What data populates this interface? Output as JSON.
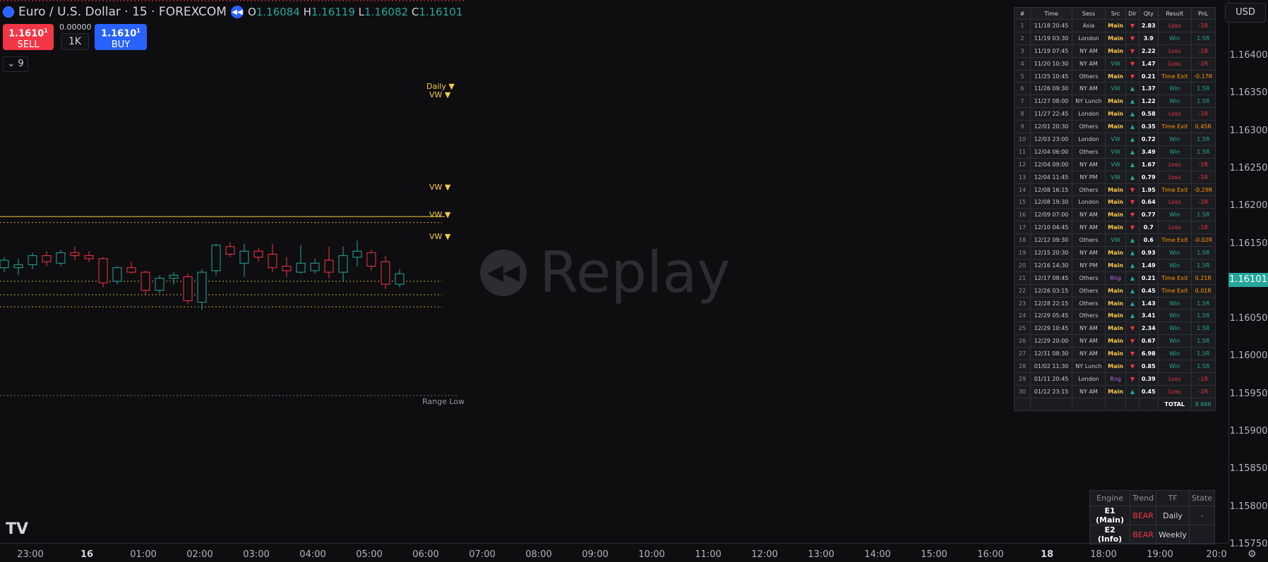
{
  "header": {
    "symbol_title": "Euro / U.S. Dollar · 15 · FOREXCOM",
    "open_label": "O",
    "open_value": "1.16084",
    "high_label": "H",
    "high_value": "1.16119",
    "low_label": "L",
    "low_value": "1.16082",
    "close_label": "C",
    "close_value": "1.16101"
  },
  "trade_panel": {
    "sell_price": "1.1610",
    "sell_price_sup": "1",
    "sell_label": "SELL",
    "spread": "0.00000",
    "quantity": "1K",
    "buy_price": "1.1610",
    "buy_price_sup": "1",
    "buy_label": "BUY"
  },
  "indicator_toggle": {
    "count": "9"
  },
  "levels": {
    "daily": "Daily ▼",
    "vw": "VW ▼",
    "range_low": "Range Low"
  },
  "watermark": {
    "text": "Replay"
  },
  "currency_button": "USD",
  "price_axis": {
    "labels": [
      "1.16400",
      "1.16350",
      "1.16300",
      "1.16250",
      "1.16200",
      "1.16150",
      "1.16050",
      "1.16000",
      "1.15950",
      "1.15900",
      "1.15850",
      "1.15800",
      "1.15750"
    ],
    "current_price": "1.16101"
  },
  "time_axis": {
    "labels": [
      "23:00",
      "16",
      "01:00",
      "02:00",
      "03:00",
      "04:00",
      "05:00",
      "06:00",
      "07:00",
      "08:00",
      "09:00",
      "10:00",
      "11:00",
      "12:00",
      "13:00",
      "14:00",
      "15:00",
      "16:00",
      "18",
      "18:00",
      "19:00",
      "20:0"
    ],
    "bold": [
      "16",
      "18"
    ]
  },
  "trades_table": {
    "headers": [
      "#",
      "Time",
      "Sess",
      "Src",
      "Dir",
      "Qty",
      "Result",
      "PnL"
    ],
    "rows": [
      [
        "1",
        "11/18 20:45",
        "Asia",
        "Main",
        "▼",
        "2.83",
        "Loss",
        "-1R"
      ],
      [
        "2",
        "11/19 03:30",
        "London",
        "Main",
        "▼",
        "3.9",
        "Win",
        "1.5R"
      ],
      [
        "3",
        "11/19 07:45",
        "NY AM",
        "Main",
        "▼",
        "2.22",
        "Loss",
        "-1R"
      ],
      [
        "4",
        "11/20 10:30",
        "NY AM",
        "VW",
        "▼",
        "1.47",
        "Loss",
        "-1R"
      ],
      [
        "5",
        "11/25 10:45",
        "Others",
        "Main",
        "▼",
        "0.21",
        "Time Exit",
        "-0.17R"
      ],
      [
        "6",
        "11/26 09:30",
        "NY AM",
        "VW",
        "▲",
        "1.37",
        "Win",
        "1.5R"
      ],
      [
        "7",
        "11/27 08:00",
        "NY Lunch",
        "Main",
        "▲",
        "1.22",
        "Win",
        "1.5R"
      ],
      [
        "8",
        "11/27 22:45",
        "London",
        "Main",
        "▲",
        "0.58",
        "Loss",
        "-1R"
      ],
      [
        "9",
        "12/01 20:30",
        "Others",
        "Main",
        "▲",
        "0.35",
        "Time Exit",
        "0.45R"
      ],
      [
        "10",
        "12/03 23:00",
        "London",
        "VW",
        "▲",
        "0.72",
        "Win",
        "1.5R"
      ],
      [
        "11",
        "12/04 06:00",
        "Others",
        "VW",
        "▲",
        "3.49",
        "Win",
        "1.5R"
      ],
      [
        "12",
        "12/04 09:00",
        "NY AM",
        "VW",
        "▲",
        "1.67",
        "Loss",
        "-1R"
      ],
      [
        "13",
        "12/04 11:45",
        "NY PM",
        "VW",
        "▲",
        "0.79",
        "Loss",
        "-1R"
      ],
      [
        "14",
        "12/08 16:15",
        "Others",
        "Main",
        "▼",
        "1.95",
        "Time Exit",
        "-0.29R"
      ],
      [
        "15",
        "12/08 19:30",
        "London",
        "Main",
        "▼",
        "0.64",
        "Loss",
        "-1R"
      ],
      [
        "16",
        "12/09 07:00",
        "NY AM",
        "Main",
        "▼",
        "0.77",
        "Win",
        "1.5R"
      ],
      [
        "17",
        "12/10 04:45",
        "NY AM",
        "Main",
        "▼",
        "0.7",
        "Loss",
        "-1R"
      ],
      [
        "18",
        "12/12 09:30",
        "Others",
        "VW",
        "▲",
        "0.6",
        "Time Exit",
        "-0.02R"
      ],
      [
        "19",
        "12/15 20:30",
        "NY AM",
        "Main",
        "▲",
        "0.93",
        "Win",
        "1.5R"
      ],
      [
        "20",
        "12/16 14:30",
        "NY PM",
        "Main",
        "▲",
        "1.49",
        "Win",
        "1.5R"
      ],
      [
        "21",
        "12/17 08:45",
        "Others",
        "Rng",
        "▲",
        "0.21",
        "Time Exit",
        "0.21R"
      ],
      [
        "22",
        "12/26 03:15",
        "Others",
        "Main",
        "▲",
        "0.45",
        "Time Exit",
        "0.01R"
      ],
      [
        "23",
        "12/28 22:15",
        "Others",
        "Main",
        "▲",
        "1.43",
        "Win",
        "1.5R"
      ],
      [
        "24",
        "12/29 05:45",
        "Others",
        "Main",
        "▲",
        "3.41",
        "Win",
        "1.5R"
      ],
      [
        "25",
        "12/29 10:45",
        "NY AM",
        "Main",
        "▼",
        "2.34",
        "Win",
        "1.5R"
      ],
      [
        "26",
        "12/29 20:00",
        "NY AM",
        "Main",
        "▼",
        "0.67",
        "Win",
        "1.5R"
      ],
      [
        "27",
        "12/31 08:30",
        "NY AM",
        "Main",
        "▼",
        "6.98",
        "Win",
        "1.5R"
      ],
      [
        "28",
        "01/02 11:30",
        "NY Lunch",
        "Main",
        "▼",
        "0.85",
        "Win",
        "1.5R"
      ],
      [
        "29",
        "01/11 20:45",
        "London",
        "Rng",
        "▼",
        "0.39",
        "Loss",
        "-1R"
      ],
      [
        "30",
        "01/12 23:15",
        "NY AM",
        "Main",
        "▲",
        "0.45",
        "Loss",
        "-1R"
      ]
    ],
    "total_label": "TOTAL",
    "total_value": "8.68R"
  },
  "engine_table": {
    "headers": [
      "Engine",
      "Trend",
      "TF",
      "State"
    ],
    "rows": [
      [
        "E1 (Main)",
        "BEAR",
        "Daily",
        "-"
      ],
      [
        "E2 (Info)",
        "BEAR",
        "Weekly",
        ""
      ]
    ]
  },
  "colors": {
    "up": "#26a69a",
    "down": "#f23645",
    "level": "#f7c948",
    "accent": "#2962ff"
  },
  "chart_data": {
    "type": "candlestick",
    "series": [
      {
        "name": "EUR/USD 15",
        "ohlc": [
          [
            1.16118,
            1.16132,
            1.16112,
            1.16128
          ],
          [
            1.16118,
            1.1613,
            1.16108,
            1.16122
          ],
          [
            1.16122,
            1.16138,
            1.16116,
            1.16134
          ],
          [
            1.16134,
            1.1614,
            1.1612,
            1.16126
          ],
          [
            1.16124,
            1.16142,
            1.1612,
            1.16138
          ],
          [
            1.16138,
            1.16146,
            1.16128,
            1.16134
          ],
          [
            1.16134,
            1.1614,
            1.16126,
            1.1613
          ],
          [
            1.1613,
            1.16132,
            1.16092,
            1.16098
          ],
          [
            1.161,
            1.1612,
            1.16096,
            1.16118
          ],
          [
            1.16118,
            1.16126,
            1.1611,
            1.16112
          ],
          [
            1.16112,
            1.16114,
            1.16082,
            1.16088
          ],
          [
            1.16088,
            1.16108,
            1.16084,
            1.16104
          ],
          [
            1.16104,
            1.16112,
            1.16096,
            1.16108
          ],
          [
            1.16106,
            1.1611,
            1.1607,
            1.16074
          ],
          [
            1.16072,
            1.16116,
            1.16062,
            1.16112
          ],
          [
            1.16114,
            1.1615,
            1.16108,
            1.16148
          ],
          [
            1.16146,
            1.16152,
            1.16132,
            1.16136
          ],
          [
            1.16124,
            1.1615,
            1.16106,
            1.1614
          ],
          [
            1.1614,
            1.16144,
            1.16126,
            1.16132
          ],
          [
            1.16136,
            1.1615,
            1.16112,
            1.16118
          ],
          [
            1.1612,
            1.16132,
            1.16106,
            1.16114
          ],
          [
            1.16112,
            1.16148,
            1.1611,
            1.16124
          ],
          [
            1.16114,
            1.1613,
            1.1611,
            1.16124
          ],
          [
            1.16128,
            1.16146,
            1.16104,
            1.16112
          ],
          [
            1.16112,
            1.16146,
            1.161,
            1.16134
          ],
          [
            1.16132,
            1.16154,
            1.1612,
            1.1614
          ],
          [
            1.16138,
            1.16142,
            1.16114,
            1.1612
          ],
          [
            1.16126,
            1.16134,
            1.1609,
            1.16096
          ],
          [
            1.16096,
            1.16116,
            1.16092,
            1.1611
          ]
        ]
      }
    ],
    "levels": {
      "daily": 1.16186,
      "vw": [
        1.16178,
        1.161,
        1.16082,
        1.16066
      ],
      "range_low": 1.15948
    },
    "ylim": [
      1.15735,
      1.16435
    ]
  }
}
